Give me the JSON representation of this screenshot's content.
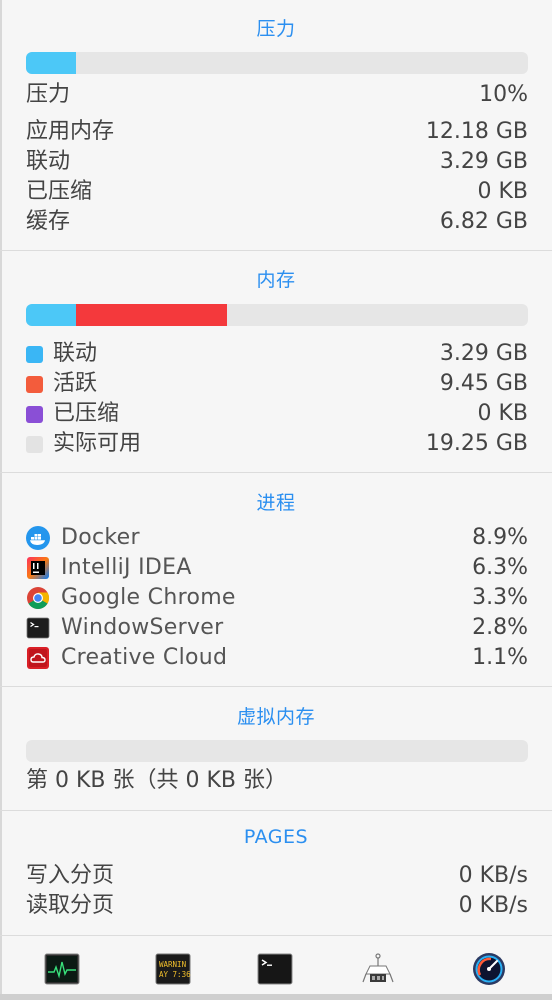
{
  "pressure": {
    "title": "压力",
    "bar_fraction": 0.1,
    "bar_color": "#4cc8f7",
    "rows": [
      {
        "label": "压力",
        "value": "10%"
      },
      {
        "label": "应用内存",
        "value": "12.18 GB"
      },
      {
        "label": "联动",
        "value": "3.29 GB"
      },
      {
        "label": "已压缩",
        "value": "0 KB"
      },
      {
        "label": "缓存",
        "value": "6.82 GB"
      }
    ]
  },
  "memory": {
    "title": "内存",
    "bar_segments": [
      {
        "fraction": 0.1,
        "color": "#4cc8f7"
      },
      {
        "fraction": 0.3,
        "color": "#f4393c"
      }
    ],
    "rows": [
      {
        "label": "联动",
        "value": "3.29 GB",
        "color": "#3ab6f5"
      },
      {
        "label": "活跃",
        "value": "9.45 GB",
        "color": "#f35c3c"
      },
      {
        "label": "已压缩",
        "value": "0 KB",
        "color": "#8a4fd6"
      },
      {
        "label": "实际可用",
        "value": "19.25 GB",
        "color": "#e3e3e3"
      }
    ]
  },
  "processes": {
    "title": "进程",
    "rows": [
      {
        "icon": "docker-icon",
        "name": "Docker",
        "value": "8.9%"
      },
      {
        "icon": "intellij-idea-icon",
        "name": "IntelliJ IDEA",
        "value": "6.3%"
      },
      {
        "icon": "google-chrome-icon",
        "name": "Google Chrome",
        "value": "3.3%"
      },
      {
        "icon": "windowserver-icon",
        "name": "WindowServer",
        "value": "2.8%"
      },
      {
        "icon": "creative-cloud-icon",
        "name": "Creative Cloud",
        "value": "1.1%"
      }
    ]
  },
  "virtual_memory": {
    "title": "虚拟内存",
    "bar_fraction": 0,
    "summary": "第 0 KB 张（共 0 KB 张）"
  },
  "pages": {
    "title": "PAGES",
    "rows": [
      {
        "label": "写入分页",
        "value": "0 KB/s"
      },
      {
        "label": "读取分页",
        "value": "0 KB/s"
      }
    ]
  },
  "toolbar": {
    "icons": [
      "activity-monitor-icon",
      "console-icon",
      "terminal-icon",
      "system-information-icon",
      "istat-menus-icon"
    ],
    "console_text_1": "WARNIN",
    "console_text_2": "AY 7:36"
  }
}
